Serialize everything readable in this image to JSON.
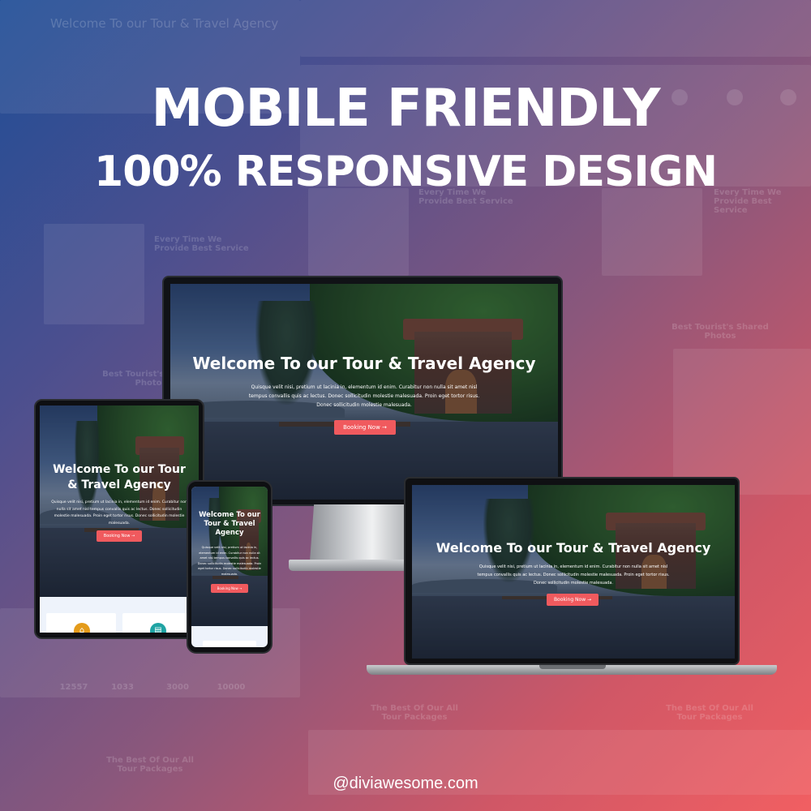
{
  "headline": "MOBILE FRIENDLY",
  "subline": "100% RESPONSIVE DESIGN",
  "hero": {
    "title": "Welcome To our Tour & Travel Agency",
    "body": "Quisque velit nisi, pretium ut lacinia in, elementum id enim. Curabitur non nulla sit amet nisl tempus convallis quis ac lectus. Donec sollicitudin molestie malesuada. Proin eget tortor risus. Donec sollicitudin molestie malesuada.",
    "button": "Booking Now →"
  },
  "tablet": {
    "title": "Welcome To our Tour & Travel Agency",
    "body": "Quisque velit nisi, pretium ut lacinia in, elementum id enim. Curabitur non nulla sit amet nisl tempus convallis quis ac lectus. Donec sollicitudin molestie malesuada. Proin eget tortor risus. Donec sollicitudin molestie malesuada.",
    "button": "Booking Now →"
  },
  "phone": {
    "title": "Welcome To our Tour & Travel Agency",
    "body": "Quisque velit nisi, pretium ut lacinia in, elementum id enim. Curabitur non nulla sit amet nisl tempus convallis quis ac lectus. Donec sollicitudin molestie malesuada. Proin eget tortor risus. Donec sollicitudin molestie malesuada.",
    "button": "Booking Now →"
  },
  "background_ghosts": {
    "top_title": "Welcome To our Tour & Travel Agency",
    "left_heading": "Every Time We Provide Best Service",
    "right_heading": "Every Time We Provide Best Service",
    "center_heading": "Every Time We Provide Best Service",
    "photos_heading": "Best Tourist's Shared Photos",
    "left_photos_heading": "Best Tourist's Shared Photos",
    "packages_left": "The Best Of Our All Tour Packages",
    "packages_center": "The Best Of Our All Tour Packages",
    "packages_right": "The Best Of Our All Tour Packages",
    "stat_1": "12557",
    "stat_2": "1033",
    "stat_3": "3000",
    "stat_4": "10000"
  },
  "footer_handle": "@diviawesome.com",
  "colors": {
    "accent": "#f05a5e",
    "bg_start": "#1f4e96",
    "bg_end": "#f15f62"
  }
}
